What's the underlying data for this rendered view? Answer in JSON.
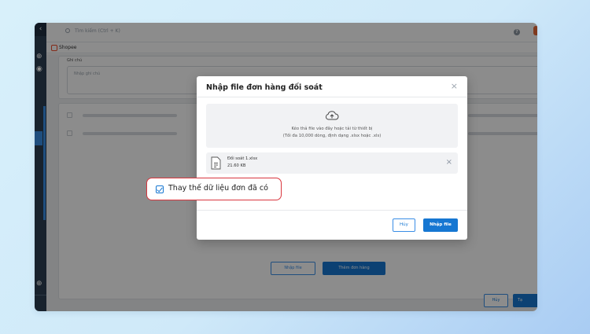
{
  "app": {
    "search_placeholder": "Tìm kiếm (Ctrl + K)",
    "help_icon_text": "?",
    "shop_name": "Shopee"
  },
  "navrail": {
    "collapse_icon": "chevron-left-icon",
    "collapse_glyph": "‹",
    "add_glyph": "⊕",
    "eye_glyph": "◉"
  },
  "form": {
    "note_label": "Ghi chú",
    "note_placeholder": "Nhập ghi chú"
  },
  "list_actions": {
    "import_label": "Nhập file",
    "add_order_label": "Thêm đơn hàng"
  },
  "footer_actions": {
    "cancel_label": "Hủy",
    "create_label": "Tạ"
  },
  "modal": {
    "title": "Nhập file đơn hàng đối soát",
    "close_glyph": "×",
    "dropzone": {
      "line1": "Kéo thả file vào đây hoặc tải từ thiết bị",
      "line2": "(Tối đa 10,000 dòng, định dạng .xlsx hoặc .xls)"
    },
    "file": {
      "name": "Đối soát 1.xlsx",
      "size": "21.60 KB",
      "remove_glyph": "×"
    },
    "replace_option": {
      "label": "Thay thế dữ liệu đơn đã có",
      "checked": true
    },
    "cancel_label": "Hủy",
    "import_label": "Nhập file"
  },
  "colors": {
    "primary": "#1677d2",
    "highlight": "#d9363e",
    "shopee": "#ee4d2d"
  }
}
